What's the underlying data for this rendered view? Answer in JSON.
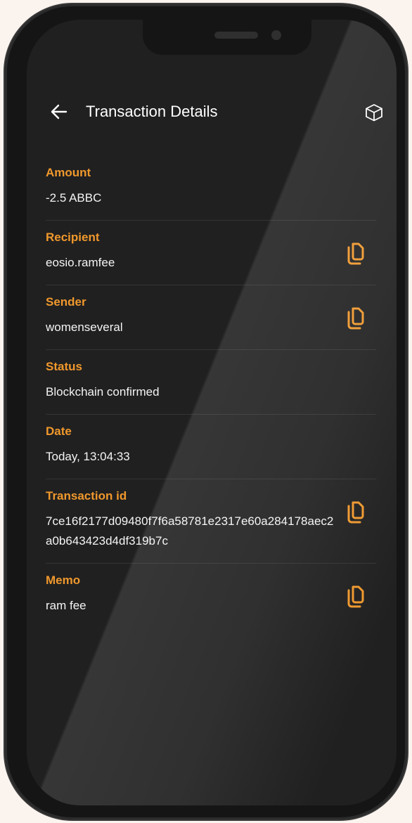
{
  "header": {
    "title": "Transaction Details",
    "back_icon": "back-arrow-icon",
    "explorer_icon": "cube-icon"
  },
  "colors": {
    "accent": "#f0982c",
    "background": "#202020",
    "text": "#f4f4f4"
  },
  "details": {
    "amount": {
      "label": "Amount",
      "value": "-2.5 ABBC"
    },
    "recipient": {
      "label": "Recipient",
      "value": "eosio.ramfee"
    },
    "sender": {
      "label": "Sender",
      "value": "womenseveral"
    },
    "status": {
      "label": "Status",
      "value": "Blockchain confirmed"
    },
    "date": {
      "label": "Date",
      "value": "Today, 13:04:33"
    },
    "transaction_id": {
      "label": "Transaction id",
      "value": "7ce16f2177d09480f7f6a58781e2317e60a284178aec2a0b643423d4df319b7c"
    },
    "memo": {
      "label": "Memo",
      "value": "ram fee"
    }
  }
}
